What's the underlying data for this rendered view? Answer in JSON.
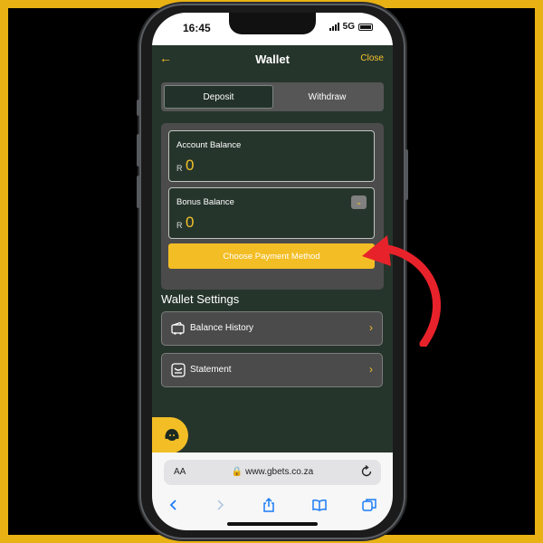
{
  "status_bar": {
    "time": "16:45",
    "network": "5G"
  },
  "header": {
    "title": "Wallet",
    "close_label": "Close"
  },
  "tabs": [
    {
      "label": "Deposit",
      "active": true
    },
    {
      "label": "Withdraw",
      "active": false
    }
  ],
  "account_balance": {
    "label": "Account Balance",
    "currency": "R",
    "amount": "0"
  },
  "bonus_balance": {
    "label": "Bonus Balance",
    "currency": "R",
    "amount": "0"
  },
  "payment_button": {
    "label": "Choose Payment Method"
  },
  "wallet_settings": {
    "title": "Wallet Settings",
    "items": [
      {
        "label": "Balance History",
        "icon": "wallet-card-icon"
      },
      {
        "label": "Statement",
        "icon": "statement-icon"
      }
    ]
  },
  "browser": {
    "text_size": "AA",
    "url": "www.gbets.co.za"
  },
  "colors": {
    "accent": "#f3be25",
    "background": "#26352c",
    "frame": "#e8b214",
    "arrow": "#e8222a"
  }
}
